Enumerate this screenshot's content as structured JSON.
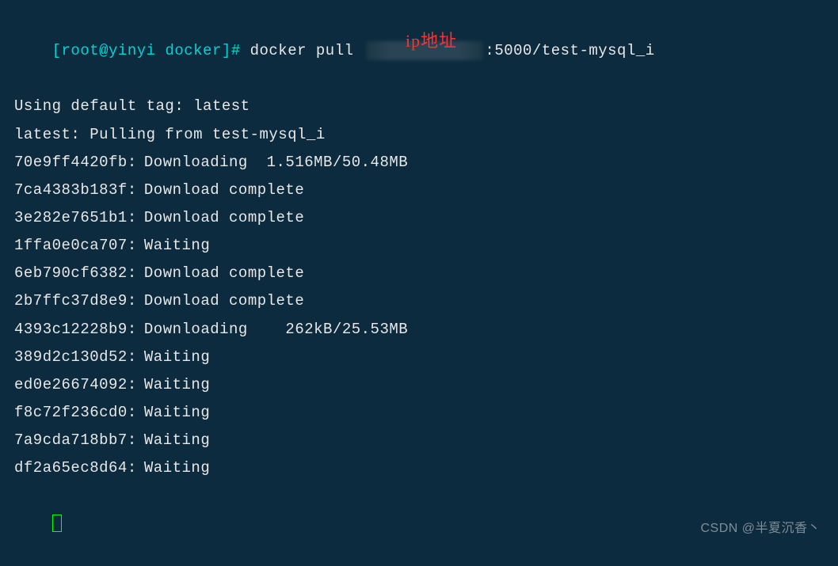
{
  "prompt": {
    "user": "root",
    "host": "yinyi",
    "cwd": "docker",
    "symbol": "#",
    "command_prefix": "docker pull ",
    "redacted_ip": "████████",
    "command_suffix": ":5000/test-mysql_i"
  },
  "annotation": "ip地址",
  "output": {
    "default_tag": "Using default tag: latest",
    "pulling_from": "latest: Pulling from test-mysql_i"
  },
  "layers": [
    {
      "hash": "70e9ff4420fb",
      "status": "Downloading  1.516MB/50.48MB"
    },
    {
      "hash": "7ca4383b183f",
      "status": "Download complete"
    },
    {
      "hash": "3e282e7651b1",
      "status": "Download complete"
    },
    {
      "hash": "1ffa0e0ca707",
      "status": "Waiting"
    },
    {
      "hash": "6eb790cf6382",
      "status": "Download complete"
    },
    {
      "hash": "2b7ffc37d8e9",
      "status": "Download complete"
    },
    {
      "hash": "4393c12228b9",
      "status": "Downloading    262kB/25.53MB"
    },
    {
      "hash": "389d2c130d52",
      "status": "Waiting"
    },
    {
      "hash": "ed0e26674092",
      "status": "Waiting"
    },
    {
      "hash": "f8c72f236cd0",
      "status": "Waiting"
    },
    {
      "hash": "7a9cda718bb7",
      "status": "Waiting"
    },
    {
      "hash": "df2a65ec8d64",
      "status": "Waiting"
    }
  ],
  "watermark": "CSDN @半夏沉香丶"
}
